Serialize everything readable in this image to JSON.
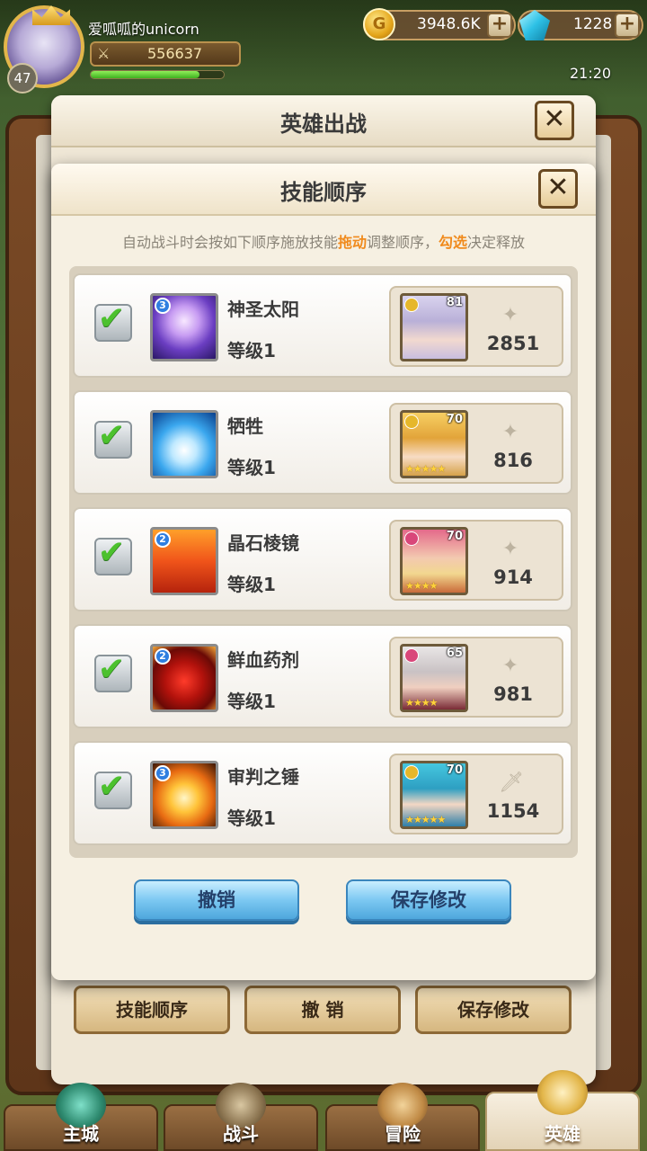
{
  "player": {
    "name": "爱呱呱的unicorn",
    "level": "47",
    "power": "556637",
    "xp_fraction": 0.82
  },
  "resources": {
    "gold": "3948.6K",
    "gems": "1228"
  },
  "clock": "21:20",
  "outer_panel": {
    "title": "英雄出战",
    "buttons": [
      "技能顺序",
      "撤 销",
      "保存修改"
    ]
  },
  "modal": {
    "title": "技能顺序",
    "hint_parts": [
      "自动战斗时会按如下顺序施放技能",
      "拖动",
      "调整顺序，",
      "勾选",
      "决定释放"
    ],
    "skills": [
      {
        "name": "神圣太阳",
        "level": "等级1",
        "badge": "3",
        "checked": true,
        "icon": "holy-sun-icon",
        "hero_level": "81",
        "hero_power": "2851"
      },
      {
        "name": "牺牲",
        "level": "等级1",
        "badge": "",
        "checked": true,
        "icon": "sacrifice-icon",
        "hero_level": "70",
        "hero_power": "816"
      },
      {
        "name": "晶石棱镜",
        "level": "等级1",
        "badge": "2",
        "checked": true,
        "icon": "crystal-prism-icon",
        "hero_level": "70",
        "hero_power": "914"
      },
      {
        "name": "鲜血药剂",
        "level": "等级1",
        "badge": "2",
        "checked": true,
        "icon": "blood-potion-icon",
        "hero_level": "65",
        "hero_power": "981"
      },
      {
        "name": "审判之锤",
        "level": "等级1",
        "badge": "3",
        "checked": true,
        "icon": "judgment-hammer-icon",
        "hero_level": "70",
        "hero_power": "1154"
      }
    ],
    "cancel_label": "撤销",
    "save_label": "保存修改"
  },
  "nav": {
    "tabs": [
      "主城",
      "战斗",
      "冒险",
      "英雄"
    ],
    "active": "英雄"
  },
  "colors": {
    "highlight": "#f08a1c",
    "check_green": "#4cc12e",
    "blue_button": "#7cc8f2"
  }
}
